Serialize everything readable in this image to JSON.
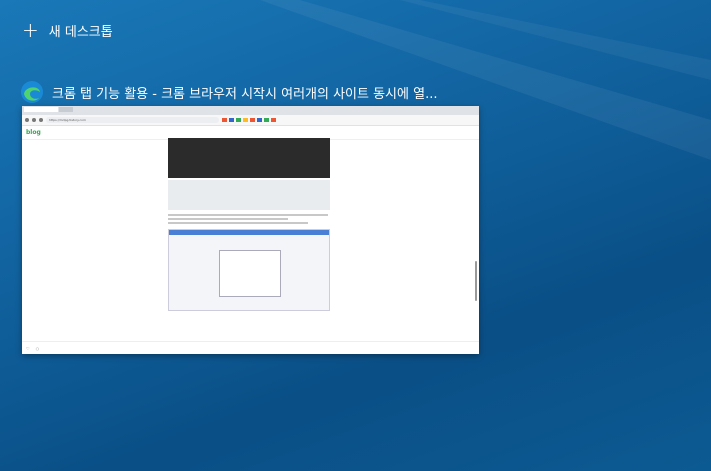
{
  "new_desktop": {
    "label": "새 데스크톱"
  },
  "window": {
    "title": "크롬 탭 기능 활용 - 크롬 브라우저 시작시 여러개의 사이트 동시에 열...",
    "url": "https://mdpg.tistory.com",
    "blog_logo": "blog"
  },
  "colors": {
    "accent": "#2fa84f",
    "desktop_bg": "#0f5e9a"
  }
}
